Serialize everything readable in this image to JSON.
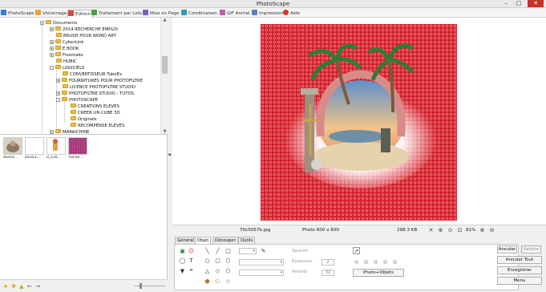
{
  "window": {
    "title": "PhotoScape"
  },
  "tabs": [
    {
      "label": "PhotoScape",
      "color": "#3b7dd8"
    },
    {
      "label": "Visionnage",
      "color": "#e8a33a"
    },
    {
      "label": "Edition",
      "color": "#d14b3f"
    },
    {
      "label": "Traitement par Lots",
      "color": "#4aa04a"
    },
    {
      "label": "Mise en Page",
      "color": "#7a5fc0"
    },
    {
      "label": "Combinaison",
      "color": "#2f9bb7"
    },
    {
      "label": "GIF Animé",
      "color": "#c05fa8"
    },
    {
      "label": "Impression",
      "color": "#5f7fc0"
    },
    {
      "label": "Aide",
      "color": "#d43a2a"
    }
  ],
  "tree": {
    "items": [
      {
        "label": "Documents",
        "expander": "-"
      },
      {
        "label": "2014 RECHERCHE EMPLOI",
        "expander": "+"
      },
      {
        "label": "BRUSH POUR WORD ART",
        "expander": ""
      },
      {
        "label": "CyberLink",
        "expander": "+"
      },
      {
        "label": "E BOOK",
        "expander": "+"
      },
      {
        "label": "Freemake",
        "expander": "+"
      },
      {
        "label": "HUBIC",
        "expander": ""
      },
      {
        "label": "LOGICIELS",
        "expander": "-"
      },
      {
        "label": "CONVERTISSEUR TubeEx",
        "expander": ""
      },
      {
        "label": "FOURNITURES POUR PHOTOFILTRE",
        "expander": "+"
      },
      {
        "label": "LICENCE PHOTOFILTRE STUDIO",
        "expander": ""
      },
      {
        "label": "PHOTOFILTRE STUDIO - TUTOS",
        "expander": "+"
      },
      {
        "label": "PHOTOSCAPE",
        "expander": "-"
      },
      {
        "label": "CREATIONS ELEVES",
        "expander": ""
      },
      {
        "label": "CREER UN CUBE 3D",
        "expander": ""
      },
      {
        "label": "Originals",
        "expander": ""
      },
      {
        "label": "RECOMPENSE ELEVES",
        "expander": ""
      },
      {
        "label": "MARAICHINE",
        "expander": "+"
      }
    ]
  },
  "thumbnails": [
    {
      "label": "divers..."
    },
    {
      "label": "a5353..."
    },
    {
      "label": "0_c20..."
    },
    {
      "label": "70c50..."
    }
  ],
  "status": {
    "filename": "70c5057b.jpg",
    "photo_info": "Photo 600 x 600",
    "filesize": "298.3 KB",
    "zoom": "81%"
  },
  "editor": {
    "tabs": [
      "Général",
      "Objet",
      "Découper",
      "Outils"
    ],
    "active_tab": "Objet",
    "opacity_label": "Opacité",
    "thickness_label": "Epaisseur",
    "thickness_value": "2",
    "rounded_label": "Arrondi",
    "rounded_value": "32",
    "photo_objects_button": "Photo+Objets"
  },
  "actions": {
    "undo": "Annuler",
    "redo": "Refaire",
    "undo_all": "Annuler Tout",
    "save": "Enregistrer",
    "menu": "Menu"
  },
  "icons": {
    "folder": "folder-icon",
    "expand": "expander-icon"
  }
}
